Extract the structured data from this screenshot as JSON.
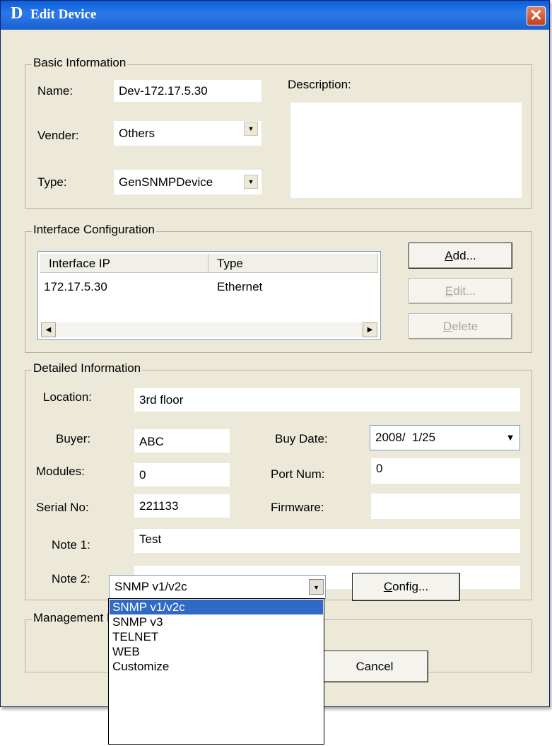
{
  "window": {
    "logo": "D",
    "title": "Edit Device",
    "close_label": "✕"
  },
  "basic": {
    "legend": "Basic Information",
    "name_label": "Name:",
    "name_value": "Dev-172.17.5.30",
    "vendor_label": "Vender:",
    "vendor_value": "Others",
    "type_label": "Type:",
    "type_value": "GenSNMPDevice",
    "description_label": "Description:",
    "description_value": ""
  },
  "interface": {
    "legend": "Interface Configuration",
    "columns": [
      "Interface IP",
      "Type"
    ],
    "rows": [
      [
        "172.17.5.30",
        "Ethernet"
      ]
    ],
    "add_label": "Add...",
    "edit_label": "Edit...",
    "delete_label": "Delete"
  },
  "detailed": {
    "legend": "Detailed Information",
    "location_label": "Location:",
    "location_value": "3rd floor",
    "buyer_label": "Buyer:",
    "buyer_value": "ABC",
    "buy_date_label": "Buy Date:",
    "buy_date_value": "2008/  1/25",
    "modules_label": "Modules:",
    "modules_value": "0",
    "port_num_label": "Port Num:",
    "port_num_value": "0",
    "serial_label": "Serial No:",
    "serial_value": "221133",
    "firmware_label": "Firmware:",
    "firmware_value": "",
    "note1_label": "Note 1:",
    "note1_value": "Test",
    "note2_label": "Note 2:",
    "note2_value": ""
  },
  "management": {
    "legend": "Management Method",
    "selected": "SNMP v1/v2c",
    "config_label": "Config...",
    "options": [
      "SNMP v1/v2c",
      "SNMP v3",
      "TELNET",
      "WEB",
      "Customize"
    ]
  },
  "footer": {
    "cancel_label": "Cancel"
  },
  "icons": {
    "dropdown_arrow": "▼",
    "scroll_left": "◀",
    "scroll_right": "▶"
  }
}
